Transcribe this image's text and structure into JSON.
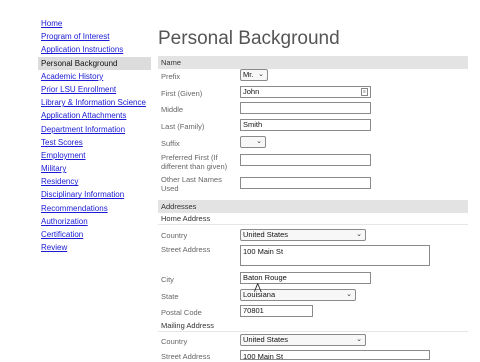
{
  "sidebar": {
    "items": [
      {
        "label": "Home"
      },
      {
        "label": "Program of Interest"
      },
      {
        "label": "Application Instructions"
      },
      {
        "label": "Personal Background"
      },
      {
        "label": "Academic History"
      },
      {
        "label": "Prior LSU Enrollment"
      },
      {
        "label": "Library & Information Science"
      },
      {
        "label": "Application Attachments"
      },
      {
        "label": "Department Information"
      },
      {
        "label": "Test Scores"
      },
      {
        "label": "Employment"
      },
      {
        "label": "Military"
      },
      {
        "label": "Residency"
      },
      {
        "label": "Disciplinary Information"
      },
      {
        "label": "Recommendations"
      },
      {
        "label": "Authorization"
      },
      {
        "label": "Certification"
      },
      {
        "label": "Review"
      }
    ],
    "active_index": 3
  },
  "page": {
    "title": "Personal Background"
  },
  "name_section": {
    "heading": "Name",
    "prefix": {
      "label": "Prefix",
      "value": "Mr."
    },
    "first": {
      "label": "First (Given)",
      "value": "John"
    },
    "middle": {
      "label": "Middle",
      "value": ""
    },
    "last": {
      "label": "Last (Family)",
      "value": "Smith"
    },
    "suffix": {
      "label": "Suffix",
      "value": ""
    },
    "preferred_first": {
      "label": "Preferred First (If different than given)",
      "value": ""
    },
    "other_last_names": {
      "label": "Other Last Names Used",
      "value": ""
    }
  },
  "addresses": {
    "heading": "Addresses",
    "home": {
      "heading": "Home Address",
      "country": {
        "label": "Country",
        "value": "United States"
      },
      "street": {
        "label": "Street Address",
        "value": "100 Main St"
      },
      "city": {
        "label": "City",
        "value": "Baton Rouge"
      },
      "state": {
        "label": "State",
        "value": "Louisiana"
      },
      "postal": {
        "label": "Postal Code",
        "value": "70801"
      }
    },
    "mailing": {
      "heading": "Mailing Address",
      "country": {
        "label": "Country",
        "value": "United States"
      },
      "street": {
        "label": "Street Address",
        "value": "100 Main St"
      }
    }
  },
  "icons": {
    "select": "chevron-down-icon",
    "contact_card": "contact-card-icon",
    "cursor": "text-cursor-icon"
  }
}
